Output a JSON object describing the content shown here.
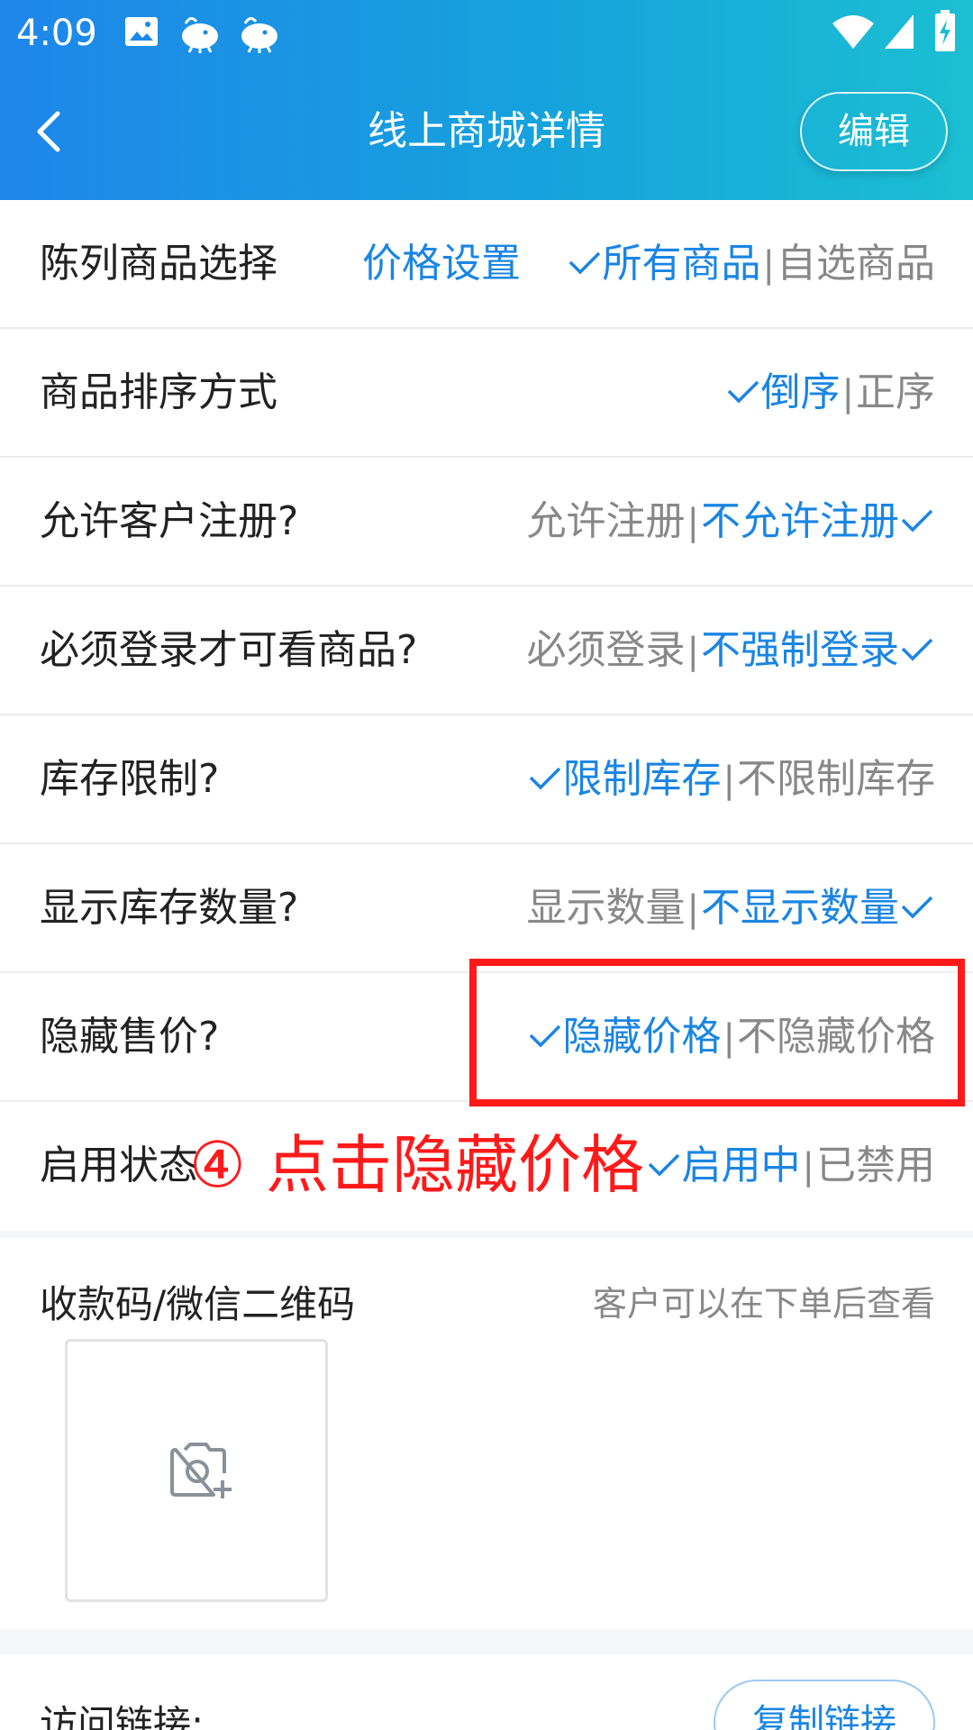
{
  "status": {
    "time": "4:09"
  },
  "header": {
    "title": "线上商城详情",
    "edit_label": "编辑"
  },
  "rows": {
    "display_select": {
      "label": "陈列商品选择",
      "price_setting": "价格设置",
      "opt1": "所有商品",
      "opt2": "自选商品"
    },
    "sort": {
      "label": "商品排序方式",
      "opt1": "倒序",
      "opt2": "正序"
    },
    "register": {
      "label": "允许客户注册?",
      "opt1": "允许注册",
      "opt2": "不允许注册"
    },
    "login": {
      "label": "必须登录才可看商品?",
      "opt1": "必须登录",
      "opt2": "不强制登录"
    },
    "stock_limit": {
      "label": "库存限制?",
      "opt1": "限制库存",
      "opt2": "不限制库存"
    },
    "stock_show": {
      "label": "显示库存数量?",
      "opt1": "显示数量",
      "opt2": "不显示数量"
    },
    "hide_price": {
      "label": "隐藏售价?",
      "opt1": "隐藏价格",
      "opt2": "不隐藏价格"
    },
    "enabled": {
      "label": "启用状态",
      "opt1": "启用中",
      "opt2": "已禁用"
    }
  },
  "separator": "|",
  "qr": {
    "label": "收款码/微信二维码",
    "hint": "客户可以在下单后查看"
  },
  "link": {
    "label": "访问链接:",
    "copy_label": "复制链接"
  },
  "annotation": {
    "text": "④ 点击隐藏价格"
  },
  "colors": {
    "accent": "#1a85e3",
    "muted": "#888888",
    "annotation": "#ff1a1a"
  }
}
